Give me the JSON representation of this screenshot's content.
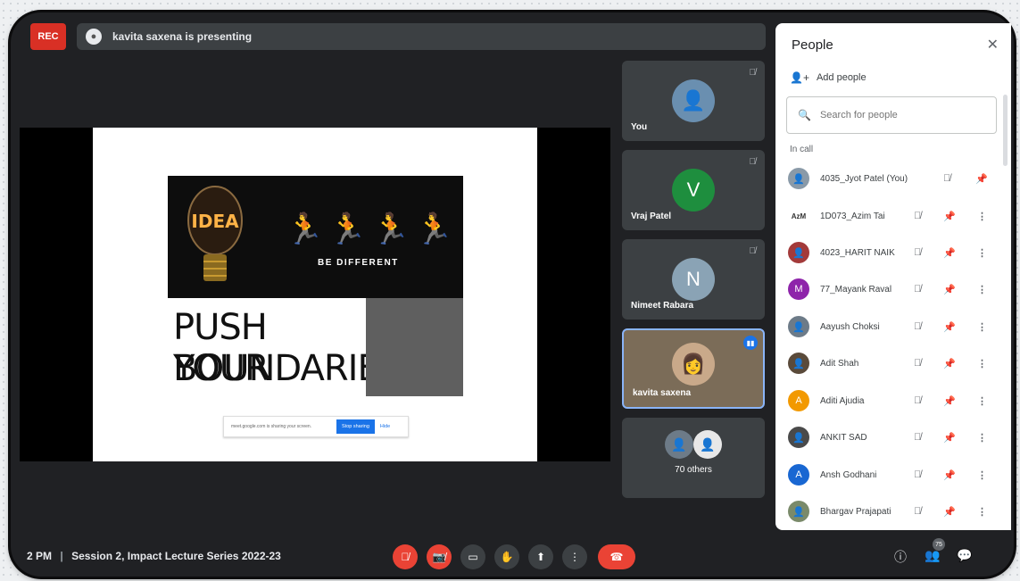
{
  "topbar": {
    "rec_label": "REC",
    "presenting_text": "kavita saxena is presenting"
  },
  "slide": {
    "idea_text": "IDEA",
    "runners": "🏃🏃🏃🏃",
    "be_different": "BE DIFFERENT",
    "push_line1": "PUSH YOUR",
    "push_line2": "BOUNDARIES",
    "share_text": "meet.google.com is sharing your screen.",
    "stop_sharing": "Stop sharing",
    "hide": "Hide"
  },
  "tiles": [
    {
      "name": "You",
      "initial": ""
    },
    {
      "name": "Vraj Patel",
      "initial": "V",
      "color": "#1e8e3e"
    },
    {
      "name": "Nimeet Rabara",
      "initial": "N",
      "color": "#8aa3b5"
    },
    {
      "name": "kavita saxena",
      "initial": ""
    },
    {
      "name": "70 others",
      "initial": ""
    }
  ],
  "people": {
    "title": "People",
    "add_people": "Add people",
    "search_placeholder": "Search for people",
    "in_call": "In call",
    "list": [
      {
        "name": "4035_Jyot Patel (You)",
        "initial": "",
        "color": "#8a9aa8"
      },
      {
        "name": "1D073_Azim Tai",
        "initial": "AzM",
        "color": "#ffffff"
      },
      {
        "name": "4023_HARIT NAIK",
        "initial": "",
        "color": "#a33a3a"
      },
      {
        "name": "77_Mayank Raval",
        "initial": "M",
        "color": "#8e24aa"
      },
      {
        "name": "Aayush Choksi",
        "initial": "",
        "color": "#6d7b88"
      },
      {
        "name": "Adit Shah",
        "initial": "",
        "color": "#5a4a3a"
      },
      {
        "name": "Aditi Ajudia",
        "initial": "A",
        "color": "#f29900"
      },
      {
        "name": "ANKIT SAD",
        "initial": "",
        "color": "#4a4a4a"
      },
      {
        "name": "Ansh Godhani",
        "initial": "A",
        "color": "#1967d2"
      },
      {
        "name": "Bhargav Prajapati",
        "initial": "",
        "color": "#7a8a6a"
      }
    ]
  },
  "bottom": {
    "time": "2 PM",
    "meeting_title": "Session 2, Impact Lecture Series 2022-23",
    "participants_count": "75"
  }
}
